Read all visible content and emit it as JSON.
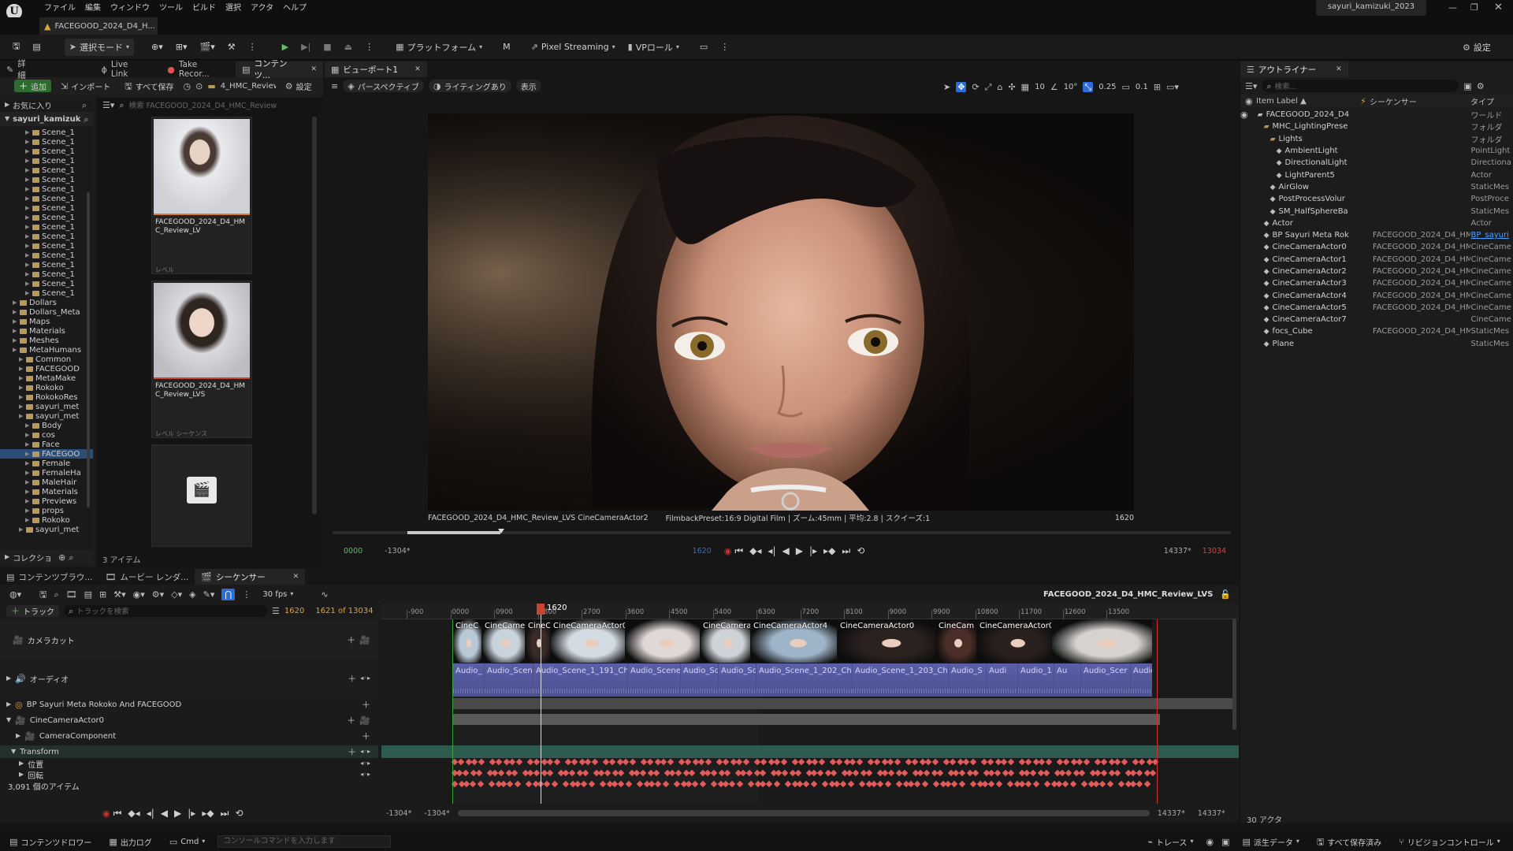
{
  "window": {
    "username": "sayuri_kamizuki_2023",
    "doc_tab": "FACEGOOD_2024_D4_H..."
  },
  "menu": [
    "ファイル",
    "編集",
    "ウィンドウ",
    "ツール",
    "ビルド",
    "選択",
    "アクタ",
    "ヘルプ"
  ],
  "toolbar": {
    "mode": "選択モード",
    "platform": "プラットフォーム",
    "pixel_streaming": "Pixel Streaming",
    "vp_roll": "VPロール",
    "settings": "設定"
  },
  "left_tabs": {
    "details": "詳細",
    "live_link": "Live Link",
    "take_recorder": "Take Recor...",
    "content": "コンテンツ..."
  },
  "content_browser": {
    "add": "追加",
    "import": "インポート",
    "save_all": "すべて保存",
    "path": "4_HMC_Review",
    "settings": "設定",
    "favorites": "お気に入り",
    "root": "sayuri_kamizuk",
    "search_placeholder": "検索 FACEGOOD_2024_D4_HMC_Review",
    "collections": "コレクショ",
    "item_count": "3 アイテム",
    "tree": [
      {
        "label": "Scene_1",
        "depth": 3
      },
      {
        "label": "Scene_1",
        "depth": 3
      },
      {
        "label": "Scene_1",
        "depth": 3
      },
      {
        "label": "Scene_1",
        "depth": 3
      },
      {
        "label": "Scene_1",
        "depth": 3
      },
      {
        "label": "Scene_1",
        "depth": 3
      },
      {
        "label": "Scene_1",
        "depth": 3
      },
      {
        "label": "Scene_1",
        "depth": 3
      },
      {
        "label": "Scene_1",
        "depth": 3
      },
      {
        "label": "Scene_1",
        "depth": 3
      },
      {
        "label": "Scene_1",
        "depth": 3
      },
      {
        "label": "Scene_1",
        "depth": 3
      },
      {
        "label": "Scene_1",
        "depth": 3
      },
      {
        "label": "Scene_1",
        "depth": 3
      },
      {
        "label": "Scene_1",
        "depth": 3
      },
      {
        "label": "Scene_1",
        "depth": 3
      },
      {
        "label": "Scene_1",
        "depth": 3
      },
      {
        "label": "Scene_1",
        "depth": 3
      },
      {
        "label": "Dollars",
        "depth": 1
      },
      {
        "label": "Dollars_Meta",
        "depth": 1
      },
      {
        "label": "Maps",
        "depth": 1
      },
      {
        "label": "Materials",
        "depth": 1
      },
      {
        "label": "Meshes",
        "depth": 1
      },
      {
        "label": "MetaHumans",
        "depth": 1
      },
      {
        "label": "Common",
        "depth": 2
      },
      {
        "label": "FACEGOOD",
        "depth": 2
      },
      {
        "label": "MetaMake",
        "depth": 2
      },
      {
        "label": "Rokoko",
        "depth": 2
      },
      {
        "label": "RokokoRes",
        "depth": 2
      },
      {
        "label": "sayuri_met",
        "depth": 2
      },
      {
        "label": "sayuri_met",
        "depth": 2
      },
      {
        "label": "Body",
        "depth": 3
      },
      {
        "label": "cos",
        "depth": 3
      },
      {
        "label": "Face",
        "depth": 3
      },
      {
        "label": "FACEGOO",
        "depth": 3,
        "selected": true
      },
      {
        "label": "Female",
        "depth": 3
      },
      {
        "label": "FemaleHa",
        "depth": 3
      },
      {
        "label": "MaleHair",
        "depth": 3
      },
      {
        "label": "Materials",
        "depth": 3
      },
      {
        "label": "Previews",
        "depth": 3
      },
      {
        "label": "props",
        "depth": 3
      },
      {
        "label": "Rokoko",
        "depth": 3
      },
      {
        "label": "sayuri_met",
        "depth": 2
      }
    ],
    "assets": [
      {
        "name": "FACEGOOD_2024_D4_HMC_Review_LV",
        "type": "レベル"
      },
      {
        "name": "FACEGOOD_2024_D4_HMC_Review_LVS",
        "type": "レベル シーケンス"
      }
    ]
  },
  "viewport": {
    "tab": "ビューポート1",
    "perspective": "パースペクティブ",
    "lighting": "ライティングあり",
    "show": "表示",
    "grid": "10",
    "angle": "10°",
    "scale": "0.25",
    "cam_speed": "0.1",
    "caption_left": "FACEGOOD_2024_D4_HMC_Review_LVS  CineCameraActor2",
    "caption_mid": "FilmbackPreset:16:9 Digital Film | ズーム:45mm | 平均:2.8 | スクイーズ:1",
    "caption_frame": "1620",
    "start": "0000",
    "range_start": "-1304*",
    "current": "1620",
    "range_end": "14337*",
    "end": "13034"
  },
  "outliner": {
    "tab": "アウトライナー",
    "search_placeholder": "検索...",
    "headers": {
      "label": "Item Label ▲",
      "sequencer": "シーケンサー",
      "type": "タイプ"
    },
    "rows": [
      {
        "label": "FACEGOOD_2024_D4",
        "seq": "",
        "type": "ワールド",
        "indent": 1
      },
      {
        "label": "MHC_LightingPrese",
        "seq": "",
        "type": "フォルダ",
        "indent": 2
      },
      {
        "label": "Lights",
        "seq": "",
        "type": "フォルダ",
        "indent": 3
      },
      {
        "label": "AmbientLight",
        "seq": "",
        "type": "PointLight",
        "indent": 4
      },
      {
        "label": "DirectionalLight",
        "seq": "",
        "type": "Directiona",
        "indent": 4
      },
      {
        "label": "LightParent5",
        "seq": "",
        "type": "Actor",
        "indent": 4
      },
      {
        "label": "AirGlow",
        "seq": "",
        "type": "StaticMes",
        "indent": 3
      },
      {
        "label": "PostProcessVolur",
        "seq": "",
        "type": "PostProce",
        "indent": 3
      },
      {
        "label": "SM_HalfSphereBa",
        "seq": "",
        "type": "StaticMes",
        "indent": 3
      },
      {
        "label": "Actor",
        "seq": "",
        "type": "Actor",
        "indent": 2
      },
      {
        "label": "BP Sayuri Meta Rok",
        "seq": "FACEGOOD_2024_D4_HMC_I",
        "type": "BP_sayuri",
        "indent": 2,
        "link": true
      },
      {
        "label": "CineCameraActor0",
        "seq": "FACEGOOD_2024_D4_HMC_I",
        "type": "CineCame",
        "indent": 2
      },
      {
        "label": "CineCameraActor1",
        "seq": "FACEGOOD_2024_D4_HMC_I",
        "type": "CineCame",
        "indent": 2
      },
      {
        "label": "CineCameraActor2",
        "seq": "FACEGOOD_2024_D4_HMC_I",
        "type": "CineCame",
        "indent": 2
      },
      {
        "label": "CineCameraActor3",
        "seq": "FACEGOOD_2024_D4_HMC_I",
        "type": "CineCame",
        "indent": 2
      },
      {
        "label": "CineCameraActor4",
        "seq": "FACEGOOD_2024_D4_HMC_I",
        "type": "CineCame",
        "indent": 2
      },
      {
        "label": "CineCameraActor5",
        "seq": "FACEGOOD_2024_D4_HMC_I",
        "type": "CineCame",
        "indent": 2
      },
      {
        "label": "CineCameraActor7",
        "seq": "",
        "type": "CineCame",
        "indent": 2
      },
      {
        "label": "focs_Cube",
        "seq": "FACEGOOD_2024_D4_HMC_I",
        "type": "StaticMes",
        "indent": 2
      },
      {
        "label": "Plane",
        "seq": "",
        "type": "StaticMes",
        "indent": 2
      }
    ],
    "count": "30 アクタ"
  },
  "bottom_tabs": {
    "content_browser": "コンテンツブラウ...",
    "movie_render": "ムービー レンダ...",
    "sequencer": "シーケンサー"
  },
  "sequencer": {
    "fps": "30 fps",
    "sequence_name": "FACEGOOD_2024_D4_HMC_Review_LVS",
    "track_button": "トラック",
    "search_placeholder": "トラックを検索",
    "current_frame": "1620",
    "frame_of": "1621 of 13034",
    "playhead": "1620",
    "ruler": [
      "-900",
      "0000",
      "0900",
      "1800",
      "2700",
      "3600",
      "4500",
      "5400",
      "6300",
      "7200",
      "8100",
      "9000",
      "9900",
      "10800",
      "11700",
      "12600",
      "13500"
    ],
    "tracks": {
      "camera_cut": "カメラカット",
      "audio": "オーディオ",
      "bp": "BP Sayuri Meta Rokoko And FACEGOOD",
      "cine": "CineCameraActor0",
      "camcomp": "CameraComponent",
      "transform": "Transform",
      "location": "位置",
      "rotation": "回転"
    },
    "item_count": "3,091 個のアイテム",
    "camera_clips": [
      "CineC",
      "CineCamera",
      "CineCa",
      "CineCameraActor0",
      "",
      "CineCamera",
      "CineCameraActor4",
      "CineCameraActor0",
      "CineCam",
      "CineCameraActor0",
      ""
    ],
    "audio_clips": [
      "Audio_",
      "Audio_Scen",
      "Audio_Scene_1_191_Char",
      "Audio_Scene_1",
      "Audio_Sc",
      "Audio_Sc",
      "Audio_Scene_1_202_Ch",
      "Audio_Scene_1_203_Cha",
      "Audio_S",
      "Audi",
      "Audio_1",
      "Au",
      "Audio_Scer",
      "Audio_"
    ],
    "range_left": "-1304*",
    "range_left2": "-1304*",
    "range_right": "14337*",
    "range_right2": "14337*"
  },
  "statusbar": {
    "content_drawer": "コンテンツドロワー",
    "output_log": "出力ログ",
    "cmd": "Cmd",
    "console_placeholder": "コンソールコマンドを入力します",
    "trace": "トレース",
    "derived_data": "派生データ",
    "all_saved": "すべて保存済み",
    "revision": "リビジョンコントロール"
  }
}
